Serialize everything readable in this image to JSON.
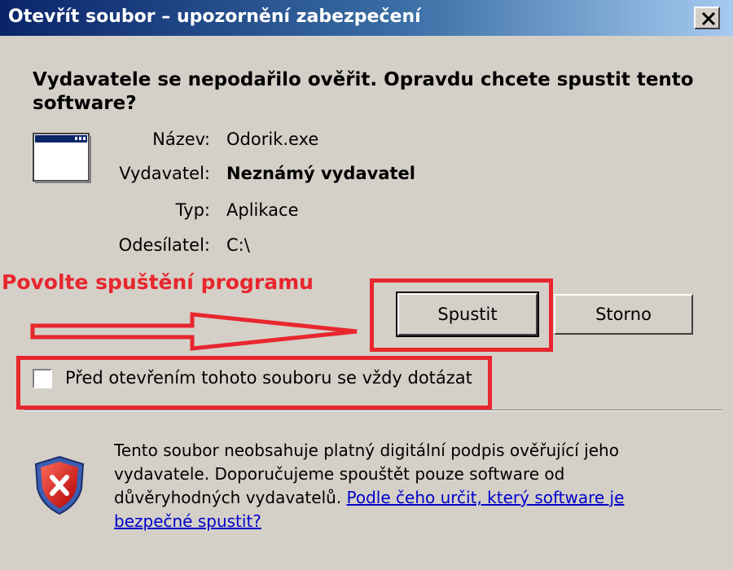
{
  "window": {
    "title": "Otevřít soubor – upozornění zabezpečení"
  },
  "dialog": {
    "heading": "Vydavatele se nepodařilo ověřit. Opravdu chcete spustit tento software?",
    "info": [
      {
        "label": "Název:",
        "value": "Odorik.exe"
      },
      {
        "label": "Vydavatel:",
        "value": "Neznámý vydavatel"
      },
      {
        "label": "Typ:",
        "value": "Aplikace"
      },
      {
        "label": "Odesílatel:",
        "value": "C:\\"
      }
    ],
    "run_button": "Spustit",
    "cancel_button": "Storno",
    "checkbox": {
      "label": "Před otevřením tohoto souboru se vždy dotázat",
      "checked": false
    },
    "warning_text": "Tento soubor neobsahuje platný digitální podpis ověřující jeho vydavatele. Doporučujeme spouštět pouze software od důvěryhodných vydavatelů.",
    "warning_link": "Podle čeho určit, který software je bezpečné spustit?"
  },
  "annotation": {
    "text": "Povolte spuštění programu",
    "color": "#e8262e"
  },
  "colors": {
    "titlebar_start": "#0a246a",
    "titlebar_end": "#a6caf0",
    "dialog_bg": "#d4d0c8",
    "link": "#0000cc"
  },
  "icons": {
    "close": "close-icon",
    "app": "application-window-icon",
    "shield": "security-shield-icon"
  }
}
